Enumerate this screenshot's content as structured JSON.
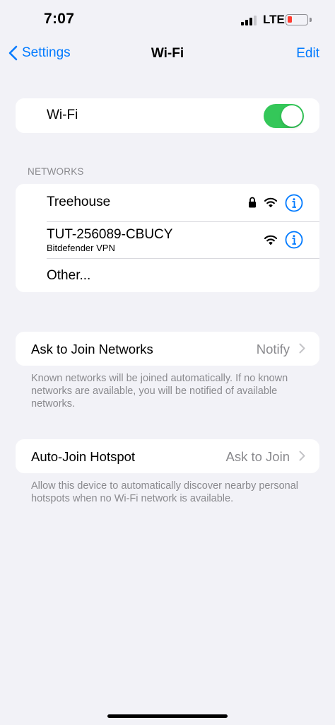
{
  "status": {
    "time": "7:07",
    "network": "LTE"
  },
  "nav": {
    "back_label": "Settings",
    "title": "Wi-Fi",
    "edit_label": "Edit"
  },
  "wifi": {
    "label": "Wi-Fi",
    "enabled": true
  },
  "networks_header": "NETWORKS",
  "networks": [
    {
      "name": "Treehouse",
      "subtitle": "",
      "secured": true
    },
    {
      "name": "TUT-256089-CBUCY",
      "subtitle": "Bitdefender VPN",
      "secured": false
    }
  ],
  "other_label": "Other...",
  "ask_to_join": {
    "label": "Ask to Join Networks",
    "value": "Notify",
    "footnote": "Known networks will be joined automatically. If no known networks are available, you will be notified of available networks."
  },
  "auto_join": {
    "label": "Auto-Join Hotspot",
    "value": "Ask to Join",
    "footnote": "Allow this device to automatically discover nearby personal hotspots when no Wi-Fi network is available."
  },
  "icons": {
    "back": "chevron-left-icon",
    "lock": "lock-icon",
    "wifi": "wifi-signal-icon",
    "info": "info-circle-icon",
    "chevron": "chevron-right-icon"
  },
  "colors": {
    "accent": "#007aff",
    "toggle_on": "#34c759",
    "battery_low": "#ff3b30"
  }
}
